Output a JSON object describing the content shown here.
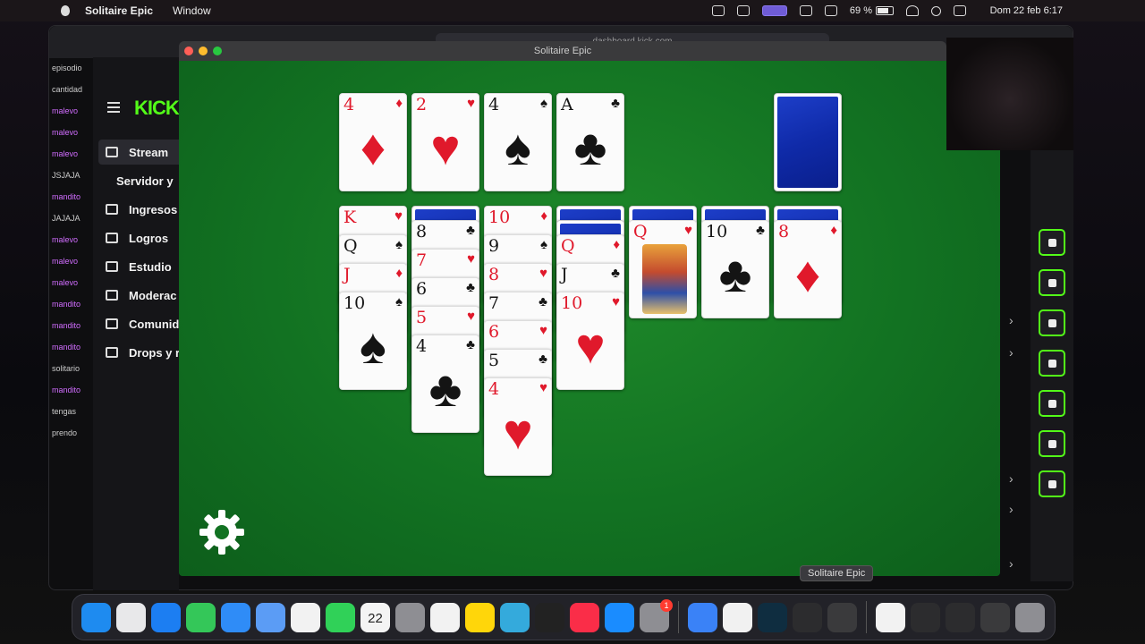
{
  "menubar": {
    "app_name": "Solitaire Epic",
    "menu_window": "Window",
    "battery": "69 %",
    "clock": "Dom 22 feb 6:17"
  },
  "browser": {
    "url": "dashboard.kick.com",
    "logo": "KICK",
    "chat_lines": [
      "episodio",
      "cantidad",
      "malevo",
      "malevo",
      "malevo",
      "JSJAJA",
      "mandito",
      "JAJAJA",
      "malevo",
      "malevo",
      "malevo",
      "mandito",
      "mandito",
      "mandito",
      "solitario",
      "mandito",
      "tengas",
      "prendo"
    ],
    "nav": [
      "Stream",
      "Servidor y",
      "Ingresos",
      "Logros",
      "Estudio",
      "Moderac",
      "Comunid",
      "Drops y r"
    ]
  },
  "window": {
    "title": "Solitaire Epic"
  },
  "foundations": [
    {
      "rank": "4",
      "suit": "♦",
      "color": "red"
    },
    {
      "rank": "2",
      "suit": "♥",
      "color": "red"
    },
    {
      "rank": "4",
      "suit": "♠",
      "color": "blk"
    },
    {
      "rank": "A",
      "suit": "♣",
      "color": "blk"
    }
  ],
  "tableau": [
    {
      "down": 0,
      "up": [
        {
          "r": "K",
          "s": "♥",
          "c": "red"
        },
        {
          "r": "Q",
          "s": "♠",
          "c": "blk"
        },
        {
          "r": "J",
          "s": "♦",
          "c": "red"
        },
        {
          "r": "10",
          "s": "♠",
          "c": "blk"
        }
      ]
    },
    {
      "down": 1,
      "up": [
        {
          "r": "8",
          "s": "♣",
          "c": "blk"
        },
        {
          "r": "7",
          "s": "♥",
          "c": "red"
        },
        {
          "r": "6",
          "s": "♣",
          "c": "blk"
        },
        {
          "r": "5",
          "s": "♥",
          "c": "red"
        },
        {
          "r": "4",
          "s": "♣",
          "c": "blk"
        }
      ]
    },
    {
      "down": 0,
      "up": [
        {
          "r": "10",
          "s": "♦",
          "c": "red"
        },
        {
          "r": "9",
          "s": "♠",
          "c": "blk"
        },
        {
          "r": "8",
          "s": "♥",
          "c": "red"
        },
        {
          "r": "7",
          "s": "♣",
          "c": "blk"
        },
        {
          "r": "6",
          "s": "♥",
          "c": "red"
        },
        {
          "r": "5",
          "s": "♣",
          "c": "blk"
        },
        {
          "r": "4",
          "s": "♥",
          "c": "red"
        }
      ]
    },
    {
      "down": 2,
      "up": [
        {
          "r": "Q",
          "s": "♦",
          "c": "red"
        },
        {
          "r": "J",
          "s": "♣",
          "c": "blk"
        },
        {
          "r": "10",
          "s": "♥",
          "c": "red"
        }
      ]
    },
    {
      "down": 1,
      "up": [
        {
          "r": "Q",
          "s": "♥",
          "c": "red"
        }
      ]
    },
    {
      "down": 1,
      "up": [
        {
          "r": "10",
          "s": "♣",
          "c": "blk"
        }
      ]
    },
    {
      "down": 1,
      "up": [
        {
          "r": "8",
          "s": "♦",
          "c": "red"
        }
      ]
    }
  ],
  "dock_tooltip": "Solitaire Epic",
  "dock_calendar_day": "22",
  "dock_badge": "1",
  "colors": {
    "felt": "#127222",
    "card_back": "#1d3ec8",
    "kick_green": "#53fc18"
  }
}
